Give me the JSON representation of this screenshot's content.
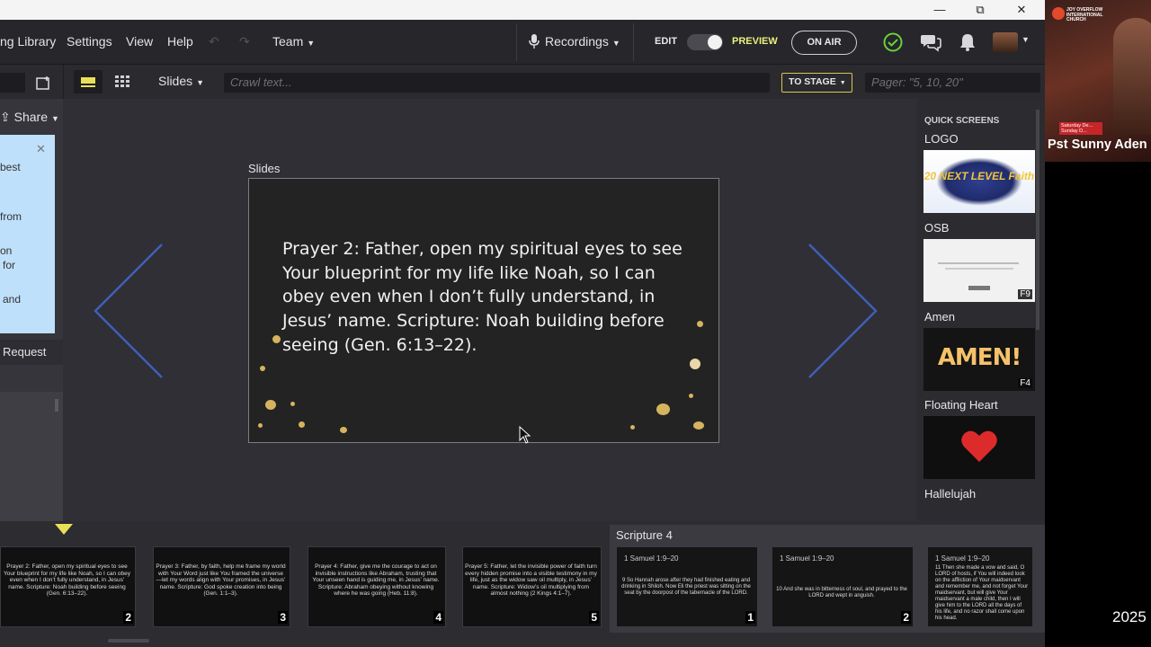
{
  "titlebar": {
    "minimize": "—",
    "maximize": "⧉",
    "close": "✕"
  },
  "menu": {
    "items": [
      "ng Library",
      "Settings",
      "View",
      "Help"
    ],
    "team": "Team",
    "recordings": "Recordings",
    "edit": "EDIT",
    "preview": "PREVIEW",
    "on_air": "ON AIR"
  },
  "toolbar": {
    "slides_label": "Slides",
    "crawl_placeholder": "Crawl text...",
    "to_stage": "TO STAGE",
    "pager_placeholder": "Pager: \"5, 10, 20\""
  },
  "left_panel": {
    "share": "Share",
    "note_lines": [
      "best",
      "from",
      "on",
      "for",
      "and"
    ],
    "request": "Request"
  },
  "stage": {
    "title": "Slides",
    "slide_text": "Prayer 2: Father, open my spiritual eyes to see Your blueprint for my life like Noah, so I can obey even when I don’t fully understand, in Jesus’ name. Scripture: Noah building before seeing (Gen. 6:13–22)."
  },
  "quick_screens": {
    "header": "QUICK SCREENS",
    "items": [
      {
        "label": "LOGO",
        "key": "",
        "art": "20 NEXT LEVEL Faith"
      },
      {
        "label": "OSB",
        "key": "F9",
        "art": ""
      },
      {
        "label": "Amen",
        "key": "F4",
        "art": "AMEN!"
      },
      {
        "label": "Floating Heart",
        "key": "",
        "art": ""
      },
      {
        "label": "Hallelujah",
        "key": "",
        "art": ""
      }
    ]
  },
  "bottom": {
    "scripture_title": "Scripture 4",
    "slides": [
      {
        "text": "Prayer 2: Father, open my spiritual eyes to see Your blueprint for my life like Noah, so I can obey even when I don’t fully understand, in Jesus’ name. Scripture: Noah building before seeing (Gen. 6:13–22).",
        "num": "2"
      },
      {
        "text": "Prayer 3: Father, by faith, help me frame my world with Your Word just like You framed the universe—let my words align with Your promises, in Jesus’ name. Scripture: God spoke creation into being (Gen. 1:1–3).",
        "num": "3"
      },
      {
        "text": "Prayer 4: Father, give me the courage to act on invisible instructions like Abraham, trusting that Your unseen hand is guiding me, in Jesus’ name. Scripture: Abraham obeying without knowing where he was going (Heb. 11:8).",
        "num": "4"
      },
      {
        "text": "Prayer 5: Father, let the invisible power of faith turn every hidden promise into a visible testimony in my life, just as the widow saw oil multiply, in Jesus’ name. Scripture: Widow’s oil multiplying from almost nothing (2 Kings 4:1–7).",
        "num": "5"
      }
    ],
    "scriptures": [
      {
        "ref": "1 Samuel 1:9–20",
        "text": "9 So Hannah arose after they had finished eating and drinking in Shiloh. Now Eli the priest was sitting on the seat by the doorpost of the tabernacle of the LORD.",
        "num": "1"
      },
      {
        "ref": "1 Samuel 1:9–20",
        "text": "10 And she was in bitterness of soul, and prayed to the LORD and wept in anguish.",
        "num": "2"
      },
      {
        "ref": "1 Samuel 1:9–20",
        "text": "11 Then she made a vow and said, O LORD of hosts, if You will indeed look on the affliction of Your maidservant and remember me, and not forget Your maidservant, but will give Your maidservant a male child, then I will give him to the LORD all the days of his life, and no razor shall come upon his head.",
        "num": ""
      }
    ]
  },
  "webcam": {
    "name": "Pst Sunny Aden",
    "logo_text": "JOY OVERFLOW INTERNATIONAL CHURCH",
    "banner": "Saturday De... Sunday D..."
  },
  "right_year": "2025",
  "colors": {
    "accent_green": "#6bd13b",
    "slide_gold": "#d6b35e",
    "arrow_blue": "#3f5fb5",
    "note_blue": "#bfe0fb"
  }
}
